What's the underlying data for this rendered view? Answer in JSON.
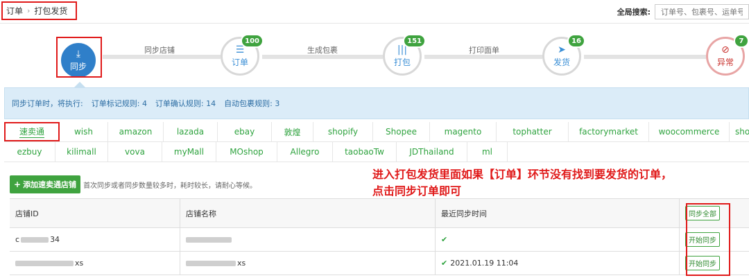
{
  "breadcrumb": {
    "root": "订单",
    "current": "打包发货"
  },
  "search": {
    "label": "全局搜索:",
    "placeholder": "订单号、包裹号、运单号"
  },
  "flow": {
    "steps": [
      {
        "label": "同步",
        "glyph": "⤓",
        "badge": ""
      },
      {
        "label": "订单",
        "glyph": "☰",
        "badge": "100"
      },
      {
        "label": "打包",
        "glyph": "|||",
        "badge": "151"
      },
      {
        "label": "发货",
        "glyph": "➤",
        "badge": "16"
      },
      {
        "label": "异常",
        "glyph": "⊘",
        "badge": "7"
      }
    ],
    "connectors": [
      "同步店铺",
      "生成包裹",
      "打印面单"
    ]
  },
  "rules": {
    "prefix": "同步订单时，将执行:",
    "items": [
      {
        "label": "订单标记规则:",
        "value": "4"
      },
      {
        "label": "订单确认规则:",
        "value": "14"
      },
      {
        "label": "自动包裹规则:",
        "value": "3"
      }
    ]
  },
  "platforms": {
    "row1": [
      "速卖通",
      "wish",
      "amazon",
      "lazada",
      "ebay",
      "敦煌",
      "shopify",
      "Shopee",
      "magento",
      "tophatter",
      "factorymarket",
      "woocommerce",
      "shopy"
    ],
    "row2": [
      "ezbuy",
      "kilimall",
      "vova",
      "myMall",
      "MOshop",
      "Allegro",
      "taobaoTw",
      "JDThailand",
      "ml"
    ]
  },
  "toolbar": {
    "add_label": "添加速卖通店铺",
    "hint": "首次同步或者同步数量较多时，耗时较长，请耐心等候。"
  },
  "annotation": {
    "line1": "进入打包发货里面如果【订单】环节没有找到要发货的订单，",
    "line2": "点击同步订单即可"
  },
  "table": {
    "headers": [
      "店铺ID",
      "店铺名称",
      "最近同步时间",
      ""
    ],
    "sync_all_label": "同步全部",
    "rows": [
      {
        "id_suffix": "34",
        "id_prefix": "c",
        "name_suffix": "",
        "time": "",
        "action": "开始同步"
      },
      {
        "id_suffix": "xs",
        "id_prefix": "",
        "name_suffix": "xs",
        "time": "2021.01.19 11:04",
        "action": "开始同步"
      }
    ]
  },
  "colors": {
    "accent": "#2f7fc9",
    "success": "#3fa33f",
    "highlight": "#e01919"
  }
}
